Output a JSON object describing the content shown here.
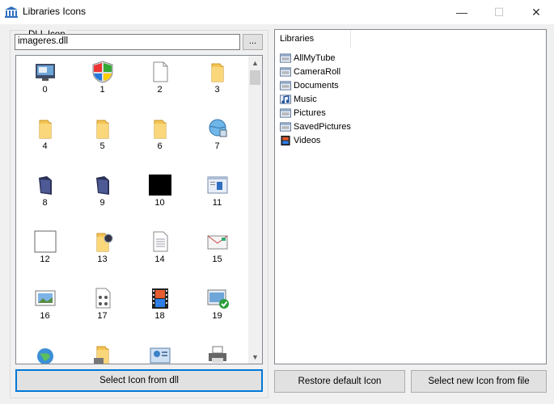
{
  "window": {
    "title": "Libraries Icons",
    "controls": {
      "minimize": "—",
      "maximize": "☐",
      "close": "✕"
    }
  },
  "dll_group": {
    "legend": "DLL Icon",
    "input_value": "imageres.dll",
    "browse_label": "..."
  },
  "icons": [
    {
      "index": "0",
      "icon": "monitor-window-icon"
    },
    {
      "index": "1",
      "icon": "windows-security-shield-icon"
    },
    {
      "index": "2",
      "icon": "blank-document-icon"
    },
    {
      "index": "3",
      "icon": "folder-icon"
    },
    {
      "index": "4",
      "icon": "folder-icon"
    },
    {
      "index": "5",
      "icon": "folder-icon"
    },
    {
      "index": "6",
      "icon": "folder-icon"
    },
    {
      "index": "7",
      "icon": "network-globe-icon"
    },
    {
      "index": "8",
      "icon": "dark-folder-icon"
    },
    {
      "index": "9",
      "icon": "dark-folder-icon"
    },
    {
      "index": "10",
      "icon": "black-square-icon"
    },
    {
      "index": "11",
      "icon": "window-app-icon"
    },
    {
      "index": "12",
      "icon": "white-square-icon"
    },
    {
      "index": "13",
      "icon": "folder-search-icon"
    },
    {
      "index": "14",
      "icon": "text-document-icon"
    },
    {
      "index": "15",
      "icon": "envelope-icon"
    },
    {
      "index": "16",
      "icon": "picture-frame-icon"
    },
    {
      "index": "17",
      "icon": "music-document-icon"
    },
    {
      "index": "18",
      "icon": "film-strip-icon"
    },
    {
      "index": "19",
      "icon": "checked-window-icon"
    },
    {
      "index": "",
      "icon": "globe-icon"
    },
    {
      "index": "",
      "icon": "folder-drive-icon"
    },
    {
      "index": "",
      "icon": "control-panel-icon"
    },
    {
      "index": "",
      "icon": "printer-icon"
    }
  ],
  "libraries": {
    "header": "Libraries",
    "items": [
      {
        "label": "AllMyTube",
        "icon": "library-window-icon"
      },
      {
        "label": "CameraRoll",
        "icon": "library-window-icon"
      },
      {
        "label": "Documents",
        "icon": "library-window-icon"
      },
      {
        "label": "Music",
        "icon": "music-library-icon"
      },
      {
        "label": "Pictures",
        "icon": "library-window-icon"
      },
      {
        "label": "SavedPictures",
        "icon": "library-window-icon"
      },
      {
        "label": "Videos",
        "icon": "video-library-icon"
      }
    ]
  },
  "buttons": {
    "select_dll": "Select Icon from dll",
    "restore_default": "Restore default Icon",
    "select_file": "Select new Icon from file"
  },
  "colors": {
    "accent_border": "#0078d7",
    "folder_yellow": "#f5c454",
    "window_bg": "#f0f0f0"
  }
}
